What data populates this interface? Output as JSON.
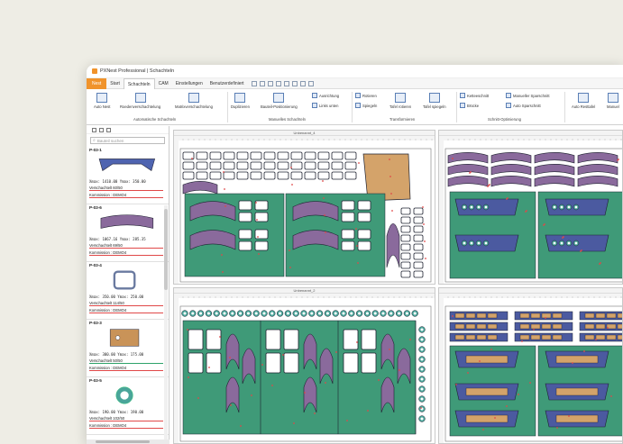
{
  "window": {
    "title": "PXNest Professional | Schachteln"
  },
  "menu": {
    "file_label": "Nest",
    "tabs": [
      "Start",
      "Schachteln",
      "CAM",
      "Einstellungen",
      "Benutzerdefiniert"
    ],
    "active_tab": "Schachteln"
  },
  "ribbon": {
    "auto_nest": "Auto Nest",
    "rowing": "Roedenverschachtelung",
    "matrix": "Matrixverschachtelung",
    "duplicate": "Duplizieren",
    "positioning": "Bauteil-Positionierung",
    "align": "Ausrichtung",
    "left_bottom": "Links unten",
    "rotate": "Rotieren",
    "mirror": "Spiegeln",
    "tafel_rotate": "Tafel rotieren",
    "tafel_mirror": "Tafel spiegeln",
    "chain_cut": "Ketteeschnitt",
    "bridges": "Brücke",
    "manual_gap": "Manueller Sparschnitt",
    "auto_gap": "Auto Sparschnitt",
    "auto_rest": "Auto Resttafel",
    "manual_rest": "Manuel",
    "group_auto": "Automatische Schachteln",
    "group_manual": "Manuelles Schachteln",
    "group_transform": "Transformieren",
    "group_cut": "Schnitt-Optimierung"
  },
  "sidebar": {
    "search_placeholder": "Bauteil suchen",
    "parts": [
      {
        "id": "P-03-1",
        "dims": "Xmax: 1410.00  Ymax: 350.00",
        "vs": "Verschachtelt 60/50",
        "kom": "Kommission : DEMO4"
      },
      {
        "id": "P-03-6",
        "dims": "Xmax: 1067.16  Ymax: 285.35",
        "vs": "Verschachtelt 69/50",
        "kom": "Kommission : DEMO4"
      },
      {
        "id": "P-03-4",
        "dims": "Xmax: 350.00  Ymax: 250.00",
        "vs": "Verschachtelt 114/50",
        "kom": "Kommission : DEMO4"
      },
      {
        "id": "P-03-3",
        "dims": "Xmax: 300.00  Ymax: 175.00",
        "vs": "Verschachtelt 50/50",
        "kom": "Kommission : DEMO4"
      },
      {
        "id": "P-03-5",
        "dims": "Xmax: 190.00  Ymax: 190.00",
        "vs": "Verschachtelt 102/50",
        "kom": "Kommission : DEMO4"
      }
    ]
  },
  "panels": {
    "p1_title": "Unbenannt_4",
    "p2_title": "",
    "p3_title": "Unbenannt_2",
    "p4_title": ""
  },
  "colors": {
    "sheet": "#3f9a78",
    "part": "#8a6a9c",
    "frame": "#4b5aa0",
    "wood": "#d4a36a"
  }
}
